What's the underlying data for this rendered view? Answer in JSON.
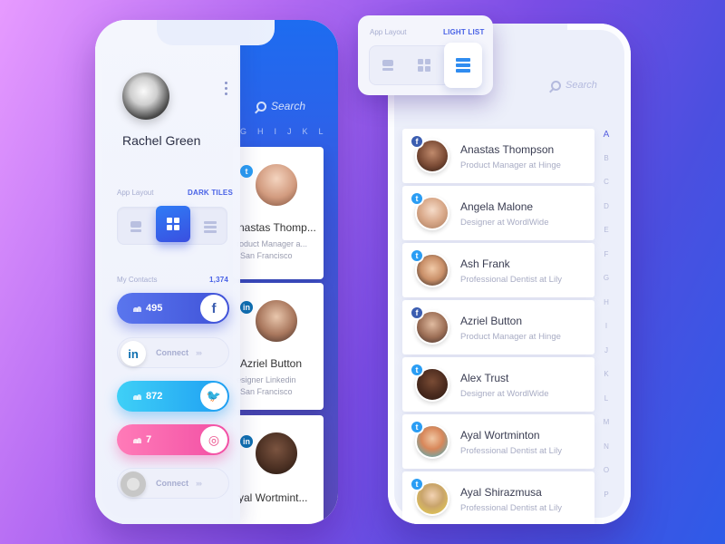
{
  "left_phone": {
    "profile": {
      "name": "Rachel Green",
      "menu_icon": "more-vertical-icon"
    },
    "layout": {
      "label": "App Layout",
      "value": "DARK TILES"
    },
    "contacts": {
      "label": "My Contacts",
      "total": "1,374",
      "items": [
        {
          "network": "facebook",
          "count": "495",
          "icon": "f",
          "color": "#4a63e0"
        },
        {
          "network": "linkedin",
          "action": "Connect",
          "arrows": "›››",
          "icon": "in"
        },
        {
          "network": "twitter",
          "count": "872",
          "color": "#2bb5f5"
        },
        {
          "network": "dribbble",
          "count": "7",
          "color": "#f256b0"
        },
        {
          "network": "generic",
          "action": "Connect",
          "arrows": "›››"
        }
      ]
    },
    "tiles": {
      "search_placeholder": "Search",
      "letters": [
        "G",
        "H",
        "I",
        "J",
        "K",
        "L"
      ],
      "cards": [
        {
          "network": "twitter",
          "name": "nastas Thomp...",
          "line1": "roduct Manager a...",
          "line2": "San Francisco"
        },
        {
          "network": "linkedin",
          "name": "Azriel Button",
          "line1": "esigner Linkedin",
          "line2": "San Francisco"
        },
        {
          "network": "linkedin",
          "name": "yal Wortmint..."
        }
      ]
    }
  },
  "float_card": {
    "label": "App Layout",
    "value": "LIGHT LIST"
  },
  "right_phone": {
    "search_placeholder": "Search",
    "contacts": [
      {
        "network": "facebook",
        "name": "Anastas Thompson",
        "title": "Product Manager at Hinge"
      },
      {
        "network": "twitter",
        "name": "Angela Malone",
        "title": "Designer at WordlWide"
      },
      {
        "network": "twitter",
        "name": "Ash Frank",
        "title": "Professional Dentist at Lily"
      },
      {
        "network": "facebook",
        "name": "Azriel Button",
        "title": "Product Manager at Hinge"
      },
      {
        "network": "twitter",
        "name": "Alex Trust",
        "title": "Designer at WordlWide"
      },
      {
        "network": "twitter",
        "name": "Ayal Wortminton",
        "title": "Professional Dentist at Lily"
      },
      {
        "network": "twitter",
        "name": "Ayal Shirazmusa",
        "title": "Professional Dentist at Lily"
      }
    ],
    "alphabet": [
      "A",
      "B",
      "C",
      "D",
      "E",
      "F",
      "G",
      "H",
      "I",
      "J",
      "K",
      "L",
      "M",
      "N",
      "O",
      "P"
    ],
    "active_letter": "A"
  },
  "colors": {
    "accent": "#4861e6",
    "facebook": "#3b5db0",
    "twitter": "#2a9df4",
    "linkedin": "#0e6fb0",
    "dribbble": "#ea4c89"
  }
}
